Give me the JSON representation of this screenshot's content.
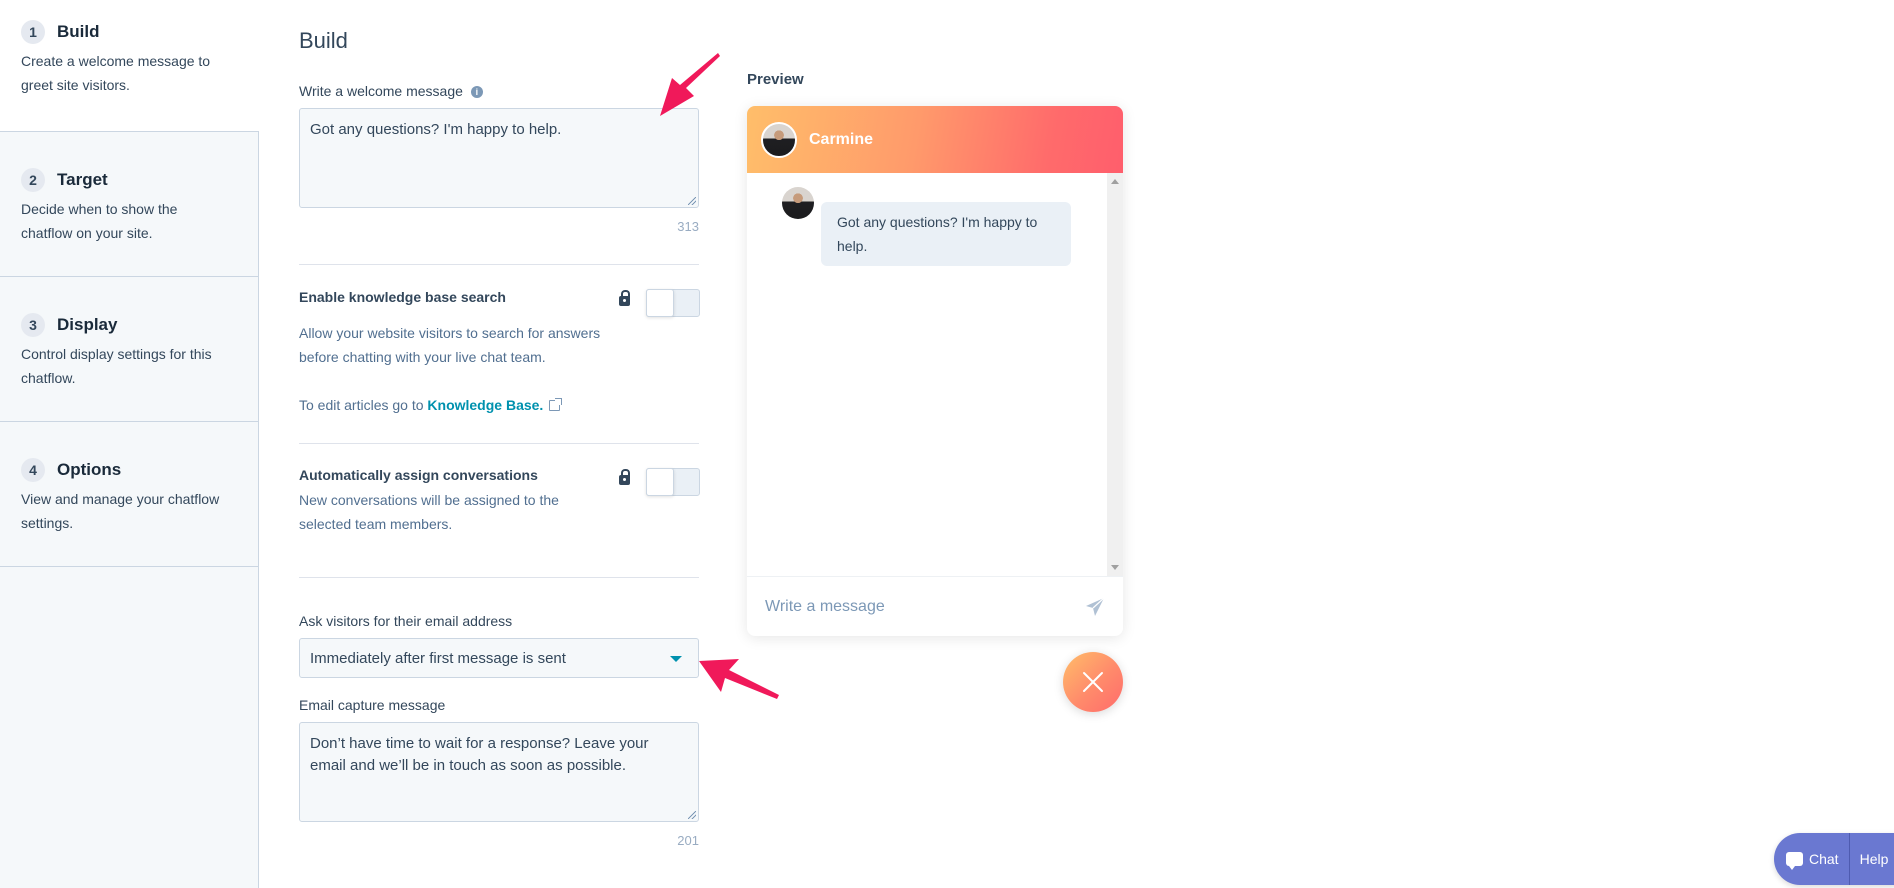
{
  "sidebar": {
    "steps": [
      {
        "number": "1",
        "title": "Build",
        "description": "Create a welcome message to greet site visitors.",
        "active": true
      },
      {
        "number": "2",
        "title": "Target",
        "description": "Decide when to show the chatflow on your site.",
        "active": false
      },
      {
        "number": "3",
        "title": "Display",
        "description": "Control display settings for this chatflow.",
        "active": false
      },
      {
        "number": "4",
        "title": "Options",
        "description": "View and manage your chatflow settings.",
        "active": false
      }
    ]
  },
  "main": {
    "title": "Build",
    "welcome": {
      "label": "Write a welcome message",
      "info_icon": "info-icon",
      "value": "Got any questions? I'm happy to help.",
      "remaining": "313"
    },
    "knowledge_base": {
      "label": "Enable knowledge base search",
      "description": "Allow your website visitors to search for answers before chatting with your live chat team.",
      "edit_prefix": "To edit articles go to ",
      "link_label": "Knowledge Base.",
      "enabled": false
    },
    "auto_assign": {
      "label": "Automatically assign conversations",
      "description": "New conversations will be assigned to the selected team members.",
      "enabled": false
    },
    "email": {
      "label": "Ask visitors for their email address",
      "selected": "Immediately after first message is sent"
    },
    "email_capture": {
      "label": "Email capture message",
      "value": "Don’t have time to wait for a response? Leave your email and we’ll be in touch as soon as possible.",
      "remaining": "201"
    }
  },
  "preview": {
    "title": "Preview",
    "agent_name": "Carmine",
    "message": "Got any questions? I'm happy to help.",
    "composer_placeholder": "Write a message",
    "header_gradient": [
      "#ffbe6a",
      "#ff5e6c"
    ],
    "annotation_color": "#f0195a"
  },
  "help_widget": {
    "chat_label": "Chat",
    "help_label": "Help",
    "color": "#6a78d1"
  }
}
